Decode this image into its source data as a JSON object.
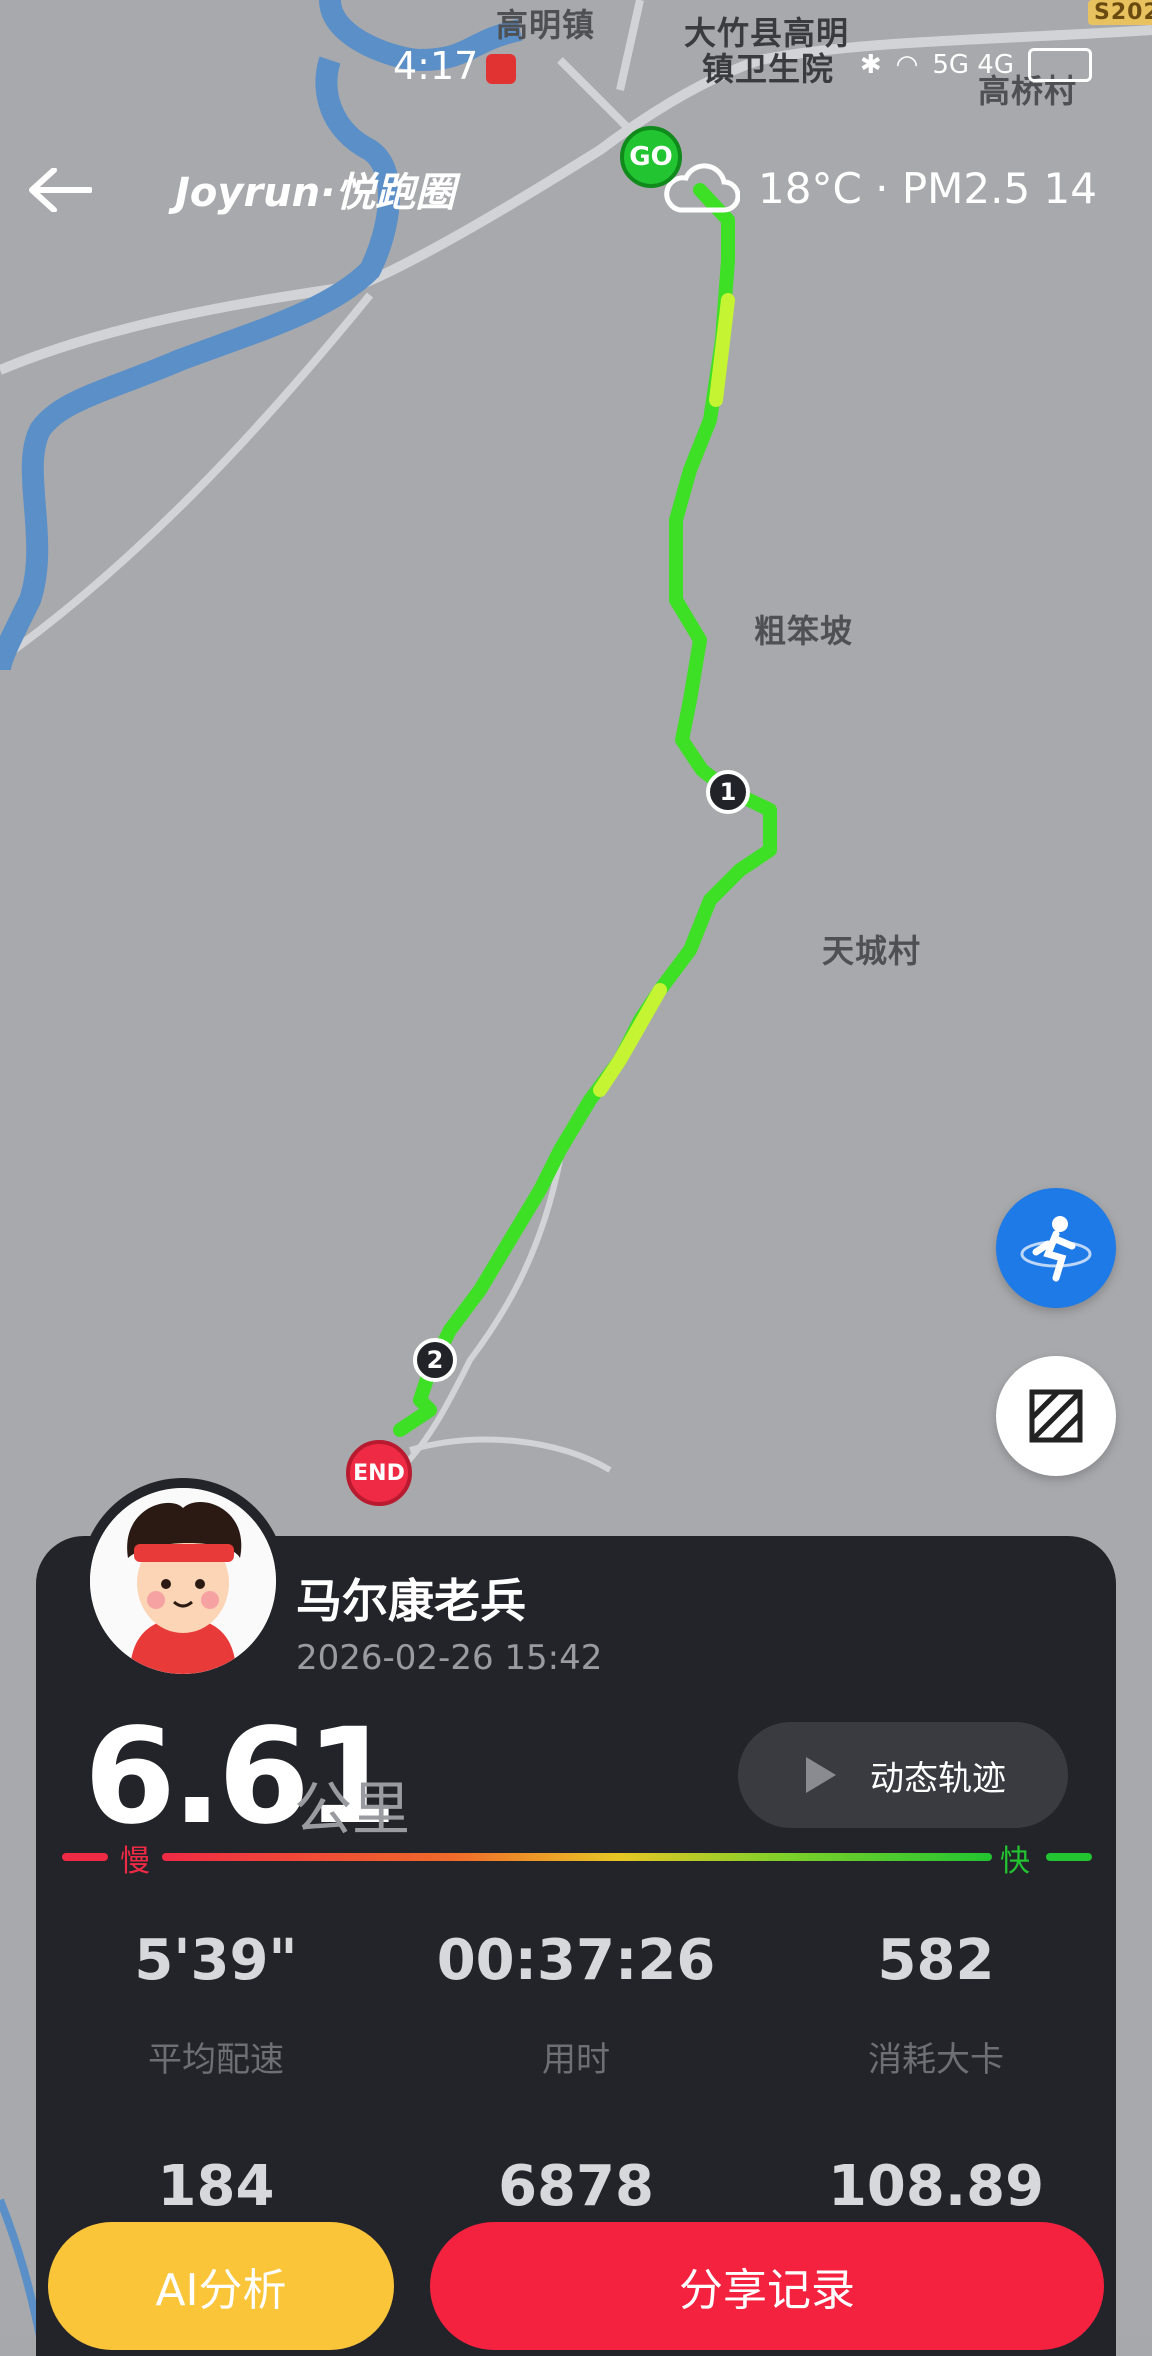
{
  "status_bar": {
    "time": "4:17",
    "network": "5G 4G"
  },
  "header": {
    "logo": "Joyrun·悦跑圈",
    "weather_text": "18°C · PM2.5 14"
  },
  "map": {
    "labels": [
      "高明镇",
      "大竹县高明",
      "镇卫生院",
      "高桥村",
      "粗笨坡",
      "天城村",
      "S202"
    ],
    "markers": {
      "start": "GO",
      "end": "END",
      "km1": "1",
      "km2": "2"
    }
  },
  "user": {
    "name": "马尔康老兵",
    "datetime": "2026-02-26 15:42"
  },
  "run": {
    "distance": "6.61",
    "distance_unit": "公里",
    "replay_label": "动态轨迹",
    "pace_slow": "慢",
    "pace_fast": "快"
  },
  "stats": [
    {
      "value": "5'39\"",
      "label": "平均配速"
    },
    {
      "value": "00:37:26",
      "label": "用时"
    },
    {
      "value": "582",
      "label": "消耗大卡"
    },
    {
      "value": "184",
      "label": ""
    },
    {
      "value": "6878",
      "label": ""
    },
    {
      "value": "108.89",
      "label": ""
    }
  ],
  "actions": {
    "ai": "AI分析",
    "share": "分享记录"
  },
  "colors": {
    "route": "#3de025",
    "start": "#22c431",
    "end": "#ef2a45",
    "accent_blue": "#1e7ae6",
    "ai_btn": "#fbc53a",
    "share_btn": "#f5223f",
    "card": "#232429"
  }
}
